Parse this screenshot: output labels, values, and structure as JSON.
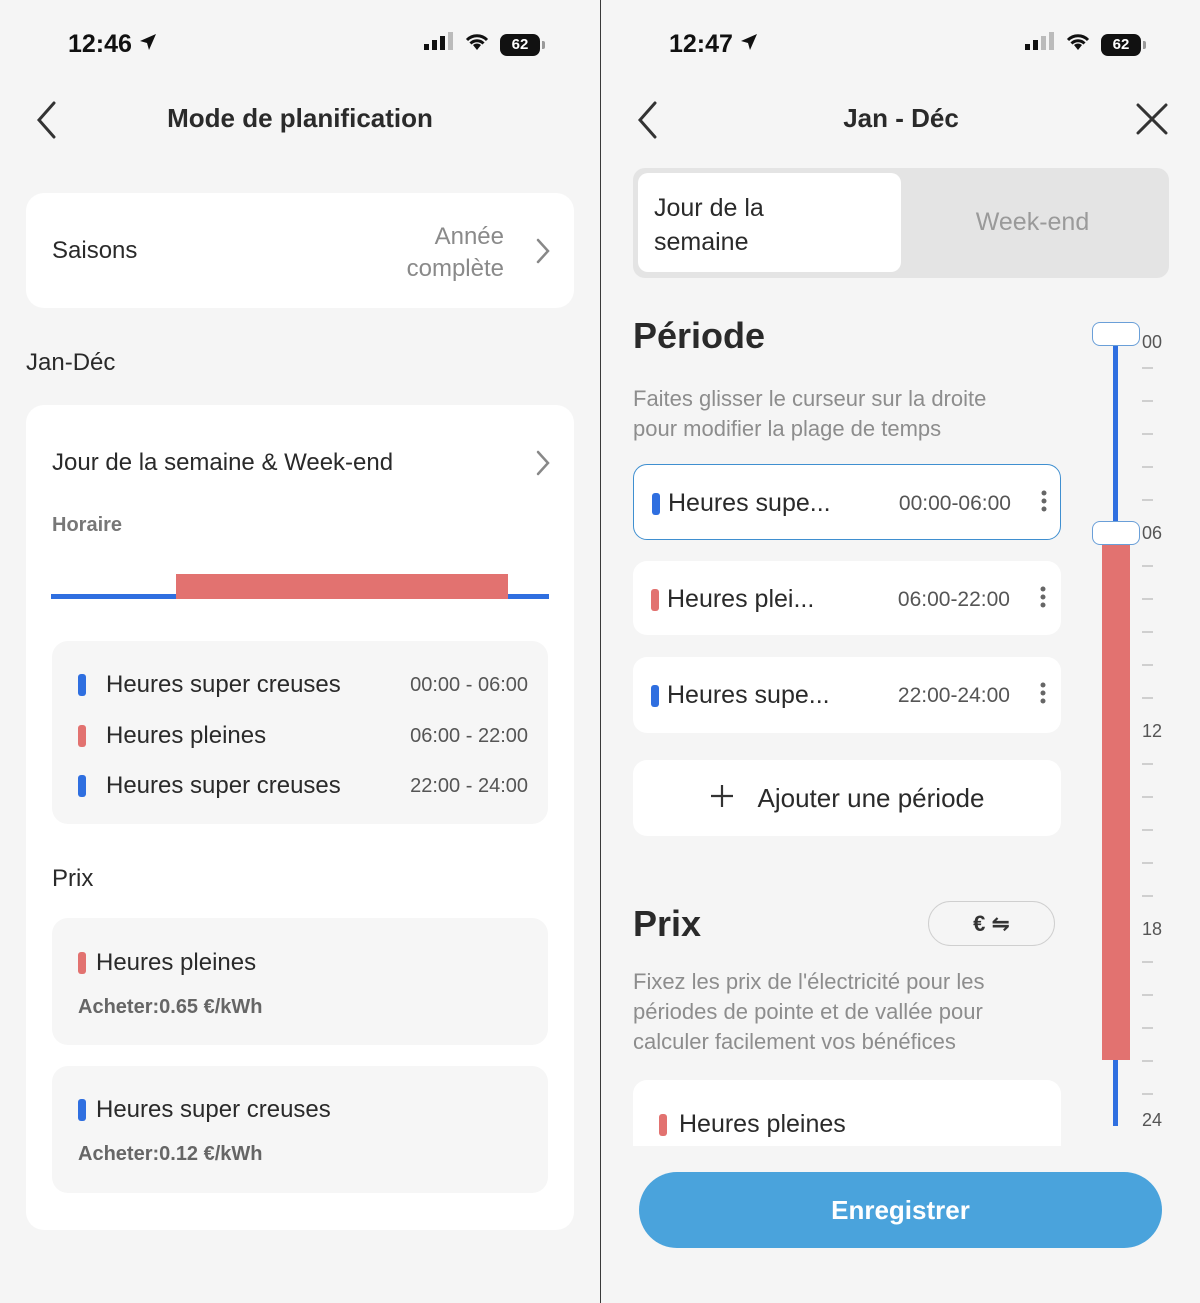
{
  "left": {
    "status": {
      "time": "12:46",
      "battery": "62"
    },
    "nav": {
      "title": "Mode de planification"
    },
    "seasons": {
      "label": "Saisons",
      "value_line1": "Année",
      "value_line2": "complète"
    },
    "section_title": "Jan-Déc",
    "schedule": {
      "title": "Jour de la semaine & Week-end",
      "horaire_label": "Horaire",
      "rows": [
        {
          "name": "Heures super creuses",
          "range": "00:00 - 06:00",
          "color": "#2f6fe0"
        },
        {
          "name": "Heures pleines",
          "range": "06:00 - 22:00",
          "color": "#e27270"
        },
        {
          "name": "Heures super creuses",
          "range": "22:00 - 24:00",
          "color": "#2f6fe0"
        }
      ],
      "prix_label": "Prix",
      "prices": [
        {
          "name": "Heures pleines",
          "price": "Acheter:0.65 €/kWh",
          "color": "#e27270"
        },
        {
          "name": "Heures super creuses",
          "price": "Acheter:0.12 €/kWh",
          "color": "#2f6fe0"
        }
      ]
    }
  },
  "right": {
    "status": {
      "time": "12:47",
      "battery": "62"
    },
    "nav": {
      "title": "Jan - Déc"
    },
    "tabs": {
      "weekday_line1": "Jour de la",
      "weekday_line2": "semaine",
      "weekend": "Week-end"
    },
    "periode": {
      "title": "Période",
      "desc_line1": "Faites glisser le curseur sur la droite",
      "desc_line2": "pour modifier la plage de temps",
      "items": [
        {
          "name": "Heures supe...",
          "range": "00:00-06:00",
          "color": "#2f6fe0"
        },
        {
          "name": "Heures plei...",
          "range": "06:00-22:00",
          "color": "#e27270"
        },
        {
          "name": "Heures supe...",
          "range": "22:00-24:00",
          "color": "#2f6fe0"
        }
      ],
      "add_label": "Ajouter une période"
    },
    "prix": {
      "title": "Prix",
      "currency_label": "€ ⇋",
      "desc_line1": "Fixez les prix de l'électricité pour les",
      "desc_line2": "périodes de pointe et de vallée pour",
      "desc_line3": "calculer facilement vos bénéfices",
      "first_item": "Heures pleines"
    },
    "slider": {
      "labels": [
        "00",
        "06",
        "12",
        "18",
        "24"
      ],
      "red_start_hour": 6,
      "red_end_hour": 22
    },
    "save_label": "Enregistrer"
  },
  "colors": {
    "blue": "#2f6fe0",
    "red": "#e27270",
    "save_button": "#4aa3dc"
  }
}
